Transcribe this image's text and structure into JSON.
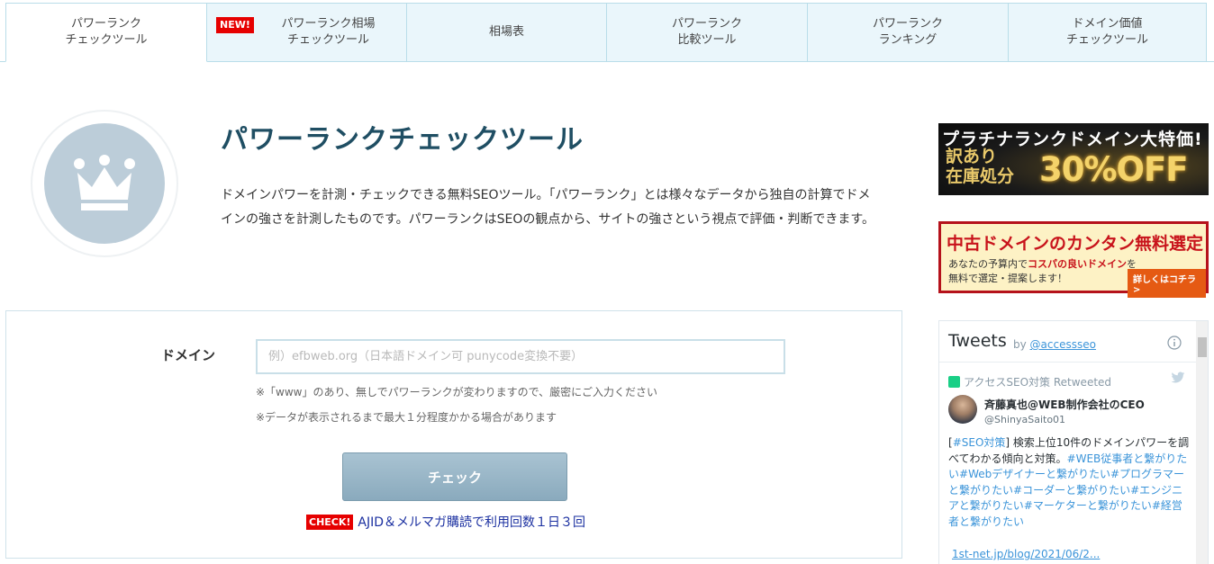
{
  "tabs": [
    {
      "label": "パワーランク\nチェックツール",
      "active": true
    },
    {
      "label": "パワーランク相場\nチェックツール",
      "badge": "NEW!"
    },
    {
      "label": "相場表"
    },
    {
      "label": "パワーランク\n比較ツール"
    },
    {
      "label": "パワーランク\nランキング"
    },
    {
      "label": "ドメイン価値\nチェックツール"
    }
  ],
  "hero": {
    "title": "パワーランクチェックツール",
    "description": "ドメインパワーを計測・チェックできる無料SEOツール。「パワーランク」とは様々なデータから独自の計算でドメインの強さを計測したものです。パワーランクはSEOの観点から、サイトの強さという視点で評価・判断できます。",
    "icon": "crown-icon"
  },
  "form": {
    "label": "ドメイン",
    "placeholder": "例）efbweb.org（日本語ドメイン可 punycode変換不要）",
    "value": "",
    "note1": "※「www」のあり、無しでパワーランクが変わりますので、厳密にご入力ください",
    "note2": "※データが表示されるまで最大１分程度かかる場合があります",
    "button": "チェック",
    "promo_badge": "CHECK!",
    "promo_text": "AJID＆メルマガ購読で利用回数１日３回"
  },
  "banner1": {
    "top": "プラチナランクドメイン大特価!",
    "left": "訳あり\n在庫処分",
    "right": "30%OFF"
  },
  "banner2": {
    "title": "中古ドメインのカンタン無料選定",
    "line1_a": "あなたの予算内で",
    "line1_hl": "コスパの良いドメイン",
    "line1_b": "を",
    "line2": "無料で選定・提案します！",
    "button": "詳しくはコチラ >"
  },
  "tweets": {
    "title": "Tweets",
    "by": "by",
    "handle": "@accessseo",
    "retweeted": "アクセスSEO対策 Retweeted",
    "author_name": "斉藤真也@WEB制作会社のCEO",
    "author_handle": "@ShinyaSaito01",
    "text_parts": [
      {
        "text": "[",
        "tag": false
      },
      {
        "text": "#SEO対策",
        "tag": true
      },
      {
        "text": "] 検索上位10件のドメインパワーを調べてわかる傾向と対策。",
        "tag": false
      },
      {
        "text": "#WEB従事者と繋がりたい",
        "tag": true
      },
      {
        "text": "#Webデザイナーと繋がりたい",
        "tag": true
      },
      {
        "text": "#プログラマーと繋がりたい",
        "tag": true
      },
      {
        "text": "#コーダーと繋がりたい",
        "tag": true
      },
      {
        "text": "#エンジニアと繋がりたい",
        "tag": true
      },
      {
        "text": "#マーケターと繋がりたい",
        "tag": true
      },
      {
        "text": "#経営者と繋がりたい",
        "tag": true
      }
    ],
    "link": "1st-net.jp/blog/2021/06/2..."
  },
  "colors": {
    "tab_bg": "#eaf6fb",
    "tab_border": "#b9dde9",
    "title": "#1f4e63",
    "accent_red": "#e60000",
    "button": "#8aaabd"
  }
}
